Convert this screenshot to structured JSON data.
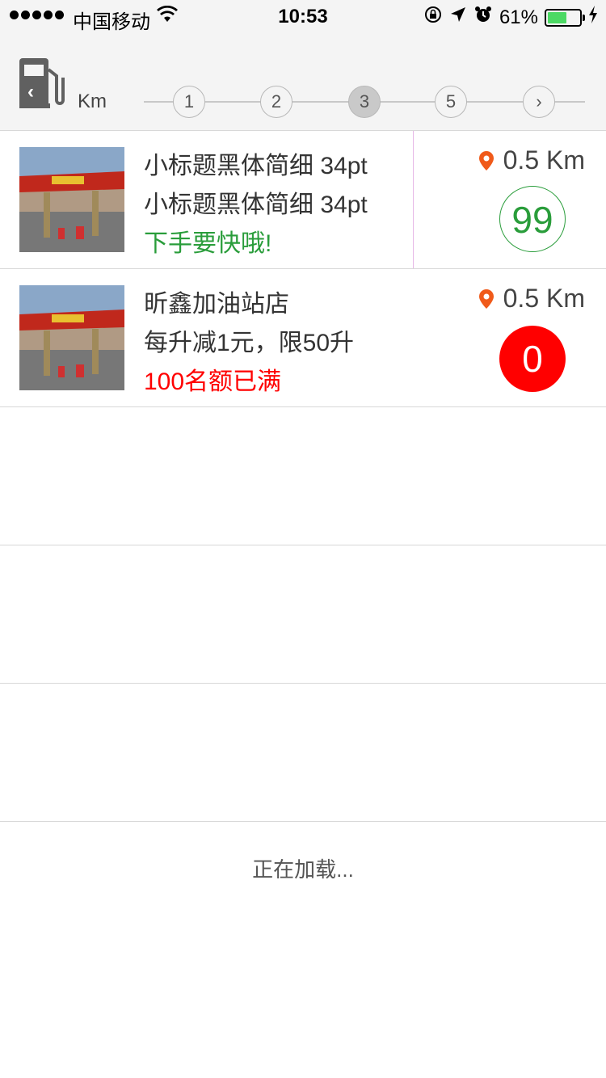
{
  "status_bar": {
    "carrier": "中国移动",
    "time": "10:53",
    "battery_percent": "61%",
    "battery_level": 0.61
  },
  "header": {
    "unit_label": "Km",
    "steps": [
      "1",
      "2",
      "3",
      "5",
      "›"
    ],
    "active_step": 2
  },
  "stations": [
    {
      "title": "小标题黑体简细 34pt",
      "subtitle": "小标题黑体简细 34pt",
      "promo": "下手要快哦!",
      "distance": "0.5 Km",
      "count": "99",
      "status": "available"
    },
    {
      "title": "昕鑫加油站店",
      "subtitle": "每升减1元，限50升",
      "promo": "100名额已满",
      "distance": "0.5 Km",
      "count": "0",
      "status": "full"
    }
  ],
  "loading_text": "正在加载...",
  "colors": {
    "accent_green": "#2a9d3b",
    "alert_red": "#ff0000",
    "pin_orange": "#f05a1a",
    "header_bg": "#f4f4f4"
  }
}
